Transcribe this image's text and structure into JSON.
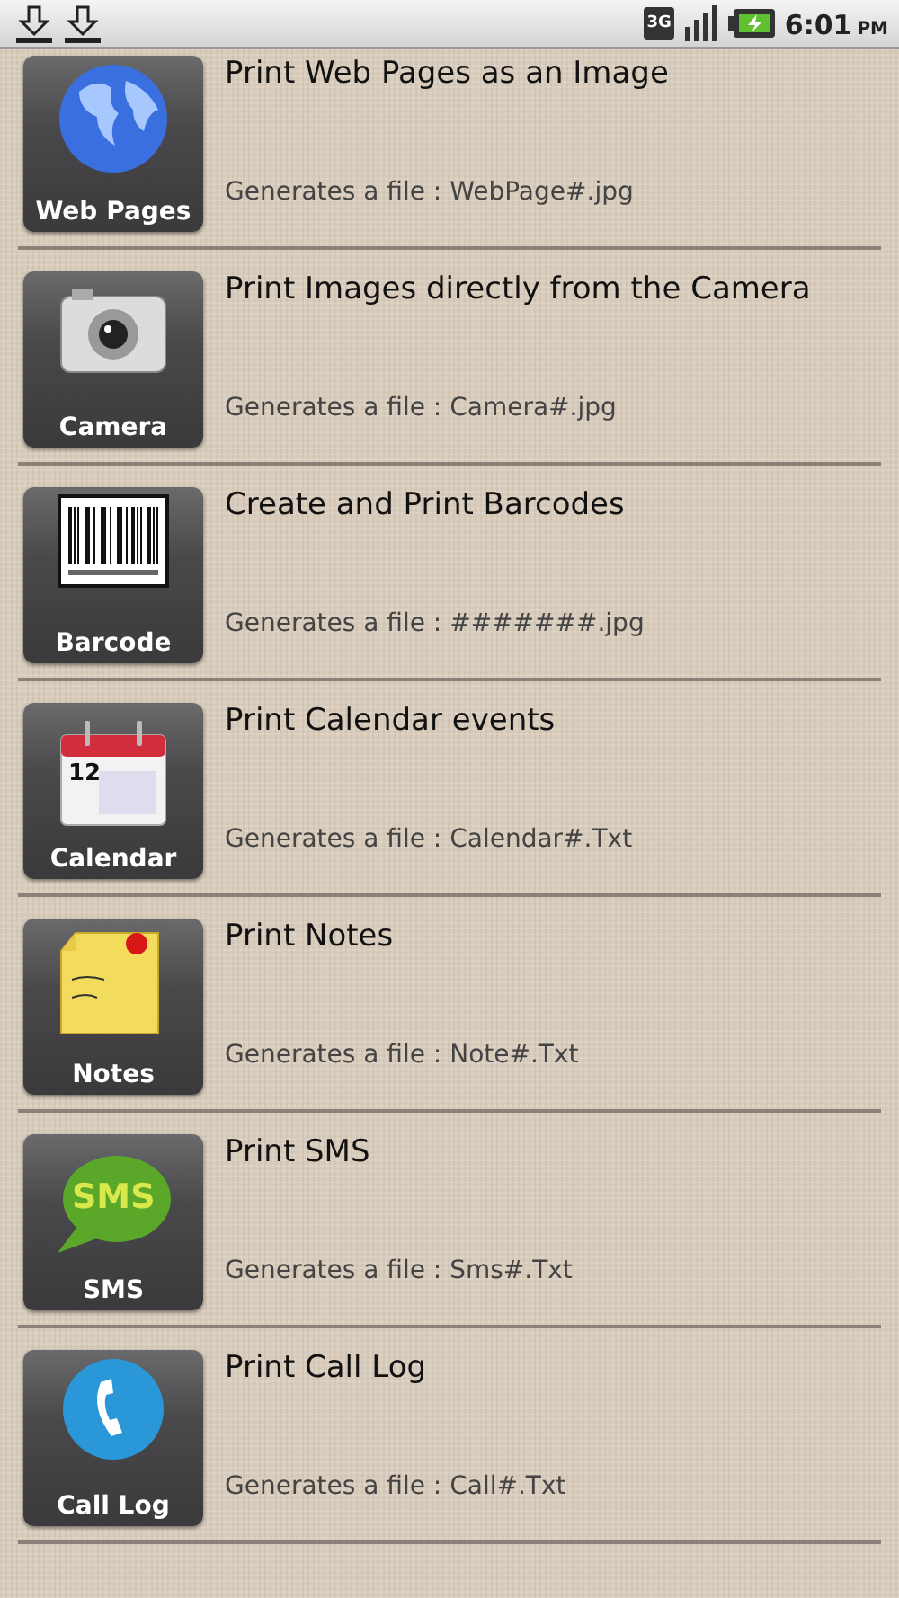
{
  "status_bar": {
    "time": "6:01",
    "meridiem": "PM",
    "network": "3G"
  },
  "items": [
    {
      "kind": "globe",
      "label": "Web Pages",
      "title": "Print Web Pages as an Image",
      "subtitle": "Generates a file : WebPage#.jpg"
    },
    {
      "kind": "camera",
      "label": "Camera",
      "title": "Print Images directly from the Camera",
      "subtitle": "Generates a file : Camera#.jpg"
    },
    {
      "kind": "barcode",
      "label": "Barcode",
      "title": "Create and Print Barcodes",
      "subtitle": "Generates a file : #######.jpg"
    },
    {
      "kind": "calendar",
      "label": "Calendar",
      "title": "Print Calendar events",
      "subtitle": "Generates a file : Calendar#.Txt",
      "icon_text": "12"
    },
    {
      "kind": "note",
      "label": "Notes",
      "title": "Print Notes",
      "subtitle": "Generates a file : Note#.Txt"
    },
    {
      "kind": "sms",
      "label": "SMS",
      "title": "Print SMS",
      "subtitle": "Generates a file : Sms#.Txt",
      "icon_text": "SMS"
    },
    {
      "kind": "phone",
      "label": "Call Log",
      "title": "Print Call Log",
      "subtitle": "Generates a file : Call#.Txt"
    }
  ]
}
